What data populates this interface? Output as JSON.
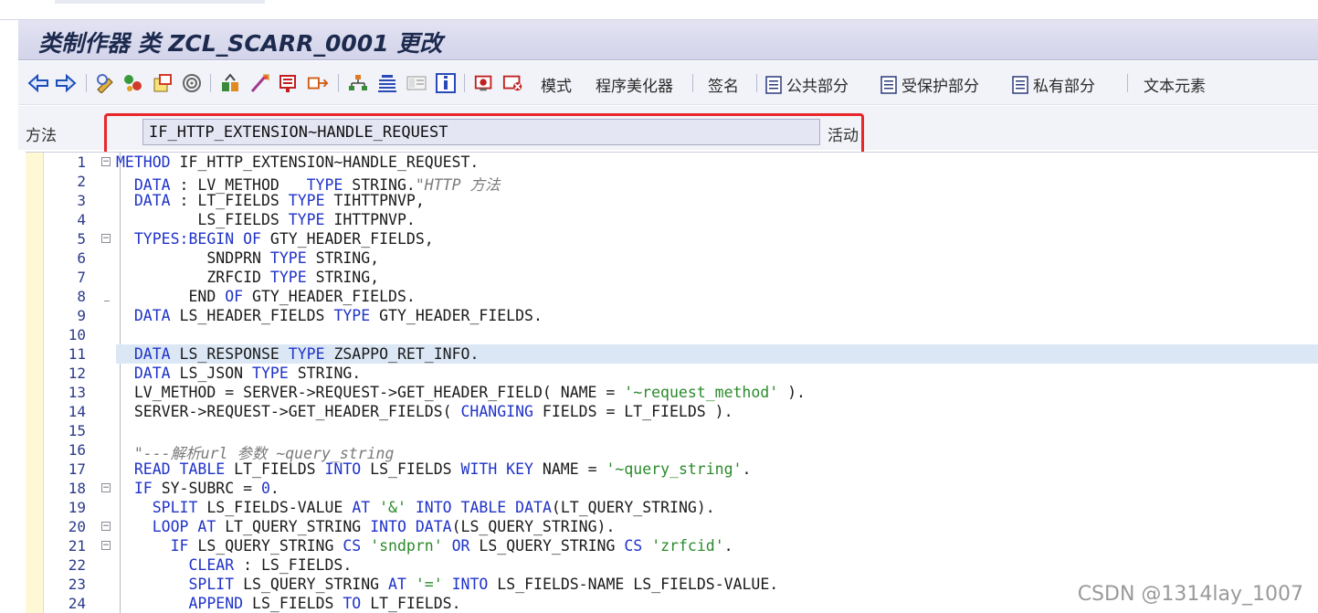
{
  "window": {
    "title": "类制作器 类 ZCL_SCARR_0001 更改"
  },
  "toolbar": {
    "buttons": [
      {
        "icon": "back-arrow-icon"
      },
      {
        "icon": "forward-arrow-icon"
      },
      {
        "icon": "display-change-icon"
      },
      {
        "icon": "other-object-icon"
      },
      {
        "icon": "active-inactive-icon"
      },
      {
        "icon": "check-icon"
      },
      {
        "icon": "activate-icon"
      },
      {
        "icon": "test-icon"
      },
      {
        "icon": "where-used-icon"
      },
      {
        "icon": "object-list-icon"
      },
      {
        "icon": "hierarchy-icon"
      },
      {
        "icon": "navigation-window-icon"
      },
      {
        "icon": "info-icon"
      },
      {
        "icon": "stop-icon"
      },
      {
        "icon": "delete-icon"
      }
    ],
    "labels": {
      "mode": "模式",
      "pretty_printer": "程序美化器",
      "signature": "签名",
      "public_section": "公共部分",
      "protected_section": "受保护部分",
      "private_section": "私有部分",
      "text_elements": "文本元素"
    }
  },
  "method_bar": {
    "label": "方法",
    "value": "IF_HTTP_EXTENSION~HANDLE_REQUEST",
    "status": "活动"
  },
  "editor": {
    "highlight_line": 11,
    "lines": [
      {
        "n": "1",
        "fold": "minus",
        "tokens": [
          [
            "k",
            "METHOD "
          ],
          [
            "n",
            "IF_HTTP_EXTENSION~HANDLE_REQUEST."
          ]
        ]
      },
      {
        "n": "2",
        "tokens": [
          [
            "n",
            "  "
          ],
          [
            "k",
            "DATA "
          ],
          [
            "n",
            ": LV_METHOD   "
          ],
          [
            "k",
            "TYPE "
          ],
          [
            "n",
            "STRING."
          ],
          [
            "c",
            "\"HTTP 方法"
          ]
        ]
      },
      {
        "n": "3",
        "tokens": [
          [
            "n",
            "  "
          ],
          [
            "k",
            "DATA "
          ],
          [
            "n",
            ": LT_FIELDS "
          ],
          [
            "k",
            "TYPE "
          ],
          [
            "n",
            "TIHTTPNVP,"
          ]
        ]
      },
      {
        "n": "4",
        "tokens": [
          [
            "n",
            "         LS_FIELDS "
          ],
          [
            "k",
            "TYPE "
          ],
          [
            "n",
            "IHTTPNVP."
          ]
        ]
      },
      {
        "n": "5",
        "fold": "minus",
        "tokens": [
          [
            "n",
            "  "
          ],
          [
            "k",
            "TYPES:BEGIN OF "
          ],
          [
            "n",
            "GTY_HEADER_FIELDS,"
          ]
        ]
      },
      {
        "n": "6",
        "tokens": [
          [
            "n",
            "          SNDPRN "
          ],
          [
            "k",
            "TYPE "
          ],
          [
            "n",
            "STRING,"
          ]
        ]
      },
      {
        "n": "7",
        "tokens": [
          [
            "n",
            "          ZRFCID "
          ],
          [
            "k",
            "TYPE "
          ],
          [
            "n",
            "STRING,"
          ]
        ]
      },
      {
        "n": "8",
        "fold": "end",
        "tokens": [
          [
            "n",
            "        END "
          ],
          [
            "k",
            "OF "
          ],
          [
            "n",
            "GTY_HEADER_FIELDS."
          ]
        ]
      },
      {
        "n": "9",
        "tokens": [
          [
            "n",
            "  "
          ],
          [
            "k",
            "DATA "
          ],
          [
            "n",
            "LS_HEADER_FIELDS "
          ],
          [
            "k",
            "TYPE "
          ],
          [
            "n",
            "GTY_HEADER_FIELDS."
          ]
        ]
      },
      {
        "n": "10",
        "tokens": []
      },
      {
        "n": "11",
        "tokens": [
          [
            "n",
            "  "
          ],
          [
            "k",
            "DATA "
          ],
          [
            "n",
            "LS_RESPONSE "
          ],
          [
            "k",
            "TYPE "
          ],
          [
            "n",
            "ZSAPPO_RET_INFO."
          ]
        ]
      },
      {
        "n": "12",
        "tokens": [
          [
            "n",
            "  "
          ],
          [
            "k",
            "DATA "
          ],
          [
            "n",
            "LS_JSON "
          ],
          [
            "k",
            "TYPE "
          ],
          [
            "n",
            "STRING."
          ]
        ]
      },
      {
        "n": "13",
        "tokens": [
          [
            "n",
            "  LV_METHOD = SERVER->REQUEST->GET_HEADER_FIELD( NAME = "
          ],
          [
            "s",
            "'~request_method'"
          ],
          [
            "n",
            " )."
          ]
        ]
      },
      {
        "n": "14",
        "tokens": [
          [
            "n",
            "  SERVER->REQUEST->GET_HEADER_FIELDS( "
          ],
          [
            "k",
            "CHANGING "
          ],
          [
            "n",
            "FIELDS = LT_FIELDS )."
          ]
        ]
      },
      {
        "n": "15",
        "tokens": []
      },
      {
        "n": "16",
        "tokens": [
          [
            "n",
            "  "
          ],
          [
            "c",
            "\"---解析url 参数 ~query_string"
          ]
        ]
      },
      {
        "n": "17",
        "tokens": [
          [
            "n",
            "  "
          ],
          [
            "k",
            "READ TABLE "
          ],
          [
            "n",
            "LT_FIELDS "
          ],
          [
            "k",
            "INTO "
          ],
          [
            "n",
            "LS_FIELDS "
          ],
          [
            "k",
            "WITH KEY "
          ],
          [
            "n",
            "NAME = "
          ],
          [
            "s",
            "'~query_string'"
          ],
          [
            "n",
            "."
          ]
        ]
      },
      {
        "n": "18",
        "fold": "minus",
        "tokens": [
          [
            "n",
            "  "
          ],
          [
            "k",
            "IF "
          ],
          [
            "n",
            "SY-SUBRC = "
          ],
          [
            "k",
            "0"
          ],
          [
            "n",
            "."
          ]
        ]
      },
      {
        "n": "19",
        "tokens": [
          [
            "n",
            "    "
          ],
          [
            "k",
            "SPLIT "
          ],
          [
            "n",
            "LS_FIELDS-VALUE "
          ],
          [
            "k",
            "AT "
          ],
          [
            "s",
            "'&'"
          ],
          [
            "n",
            " "
          ],
          [
            "k",
            "INTO TABLE DATA"
          ],
          [
            "n",
            "(LT_QUERY_STRING)."
          ]
        ]
      },
      {
        "n": "20",
        "fold": "minus",
        "tokens": [
          [
            "n",
            "    "
          ],
          [
            "k",
            "LOOP AT "
          ],
          [
            "n",
            "LT_QUERY_STRING "
          ],
          [
            "k",
            "INTO DATA"
          ],
          [
            "n",
            "(LS_QUERY_STRING)."
          ]
        ]
      },
      {
        "n": "21",
        "fold": "minus",
        "tokens": [
          [
            "n",
            "      "
          ],
          [
            "k",
            "IF "
          ],
          [
            "n",
            "LS_QUERY_STRING "
          ],
          [
            "k",
            "CS "
          ],
          [
            "s",
            "'sndprn'"
          ],
          [
            "n",
            " "
          ],
          [
            "k",
            "OR "
          ],
          [
            "n",
            "LS_QUERY_STRING "
          ],
          [
            "k",
            "CS "
          ],
          [
            "s",
            "'zrfcid'"
          ],
          [
            "n",
            "."
          ]
        ]
      },
      {
        "n": "22",
        "tokens": [
          [
            "n",
            "        "
          ],
          [
            "k",
            "CLEAR "
          ],
          [
            "n",
            ": LS_FIELDS."
          ]
        ]
      },
      {
        "n": "23",
        "tokens": [
          [
            "n",
            "        "
          ],
          [
            "k",
            "SPLIT "
          ],
          [
            "n",
            "LS_QUERY_STRING "
          ],
          [
            "k",
            "AT "
          ],
          [
            "s",
            "'='"
          ],
          [
            "n",
            " "
          ],
          [
            "k",
            "INTO "
          ],
          [
            "n",
            "LS_FIELDS-NAME LS_FIELDS-VALUE."
          ]
        ]
      },
      {
        "n": "24",
        "tokens": [
          [
            "n",
            "        "
          ],
          [
            "k",
            "APPEND "
          ],
          [
            "n",
            "LS_FIELDS "
          ],
          [
            "k",
            "TO "
          ],
          [
            "n",
            "LT_FIELDS."
          ]
        ]
      }
    ]
  },
  "watermark": "CSDN @1314lay_1007",
  "colors": {
    "keyword": "#1f33c8",
    "string": "#2a8a2a",
    "comment": "#7a7a7a",
    "highlight_box": "#e8262b"
  }
}
